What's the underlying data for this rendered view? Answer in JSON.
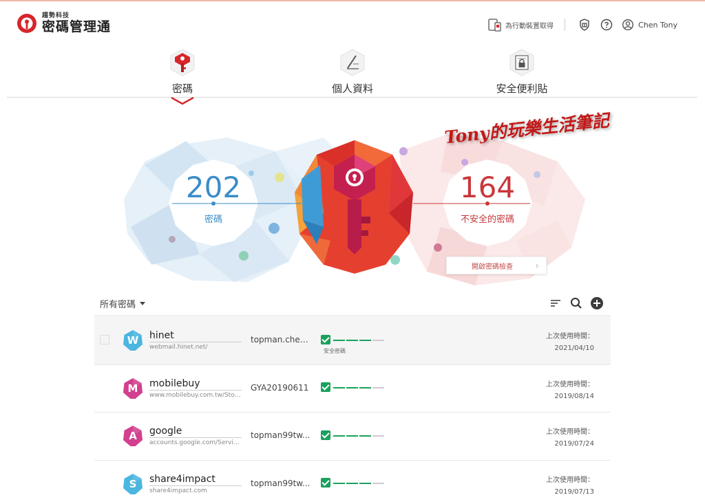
{
  "brand": {
    "company": "趨勢科技",
    "product": "密碼管理通",
    "accent": "#d6262b"
  },
  "header": {
    "mobile_label": "為行動裝置取得",
    "user_name": "Chen Tony",
    "icons": [
      "mobile-device-icon",
      "shield-gift-icon",
      "help-icon",
      "user-icon"
    ]
  },
  "tabs": [
    {
      "label": "密碼",
      "icon": "key-icon",
      "active": true
    },
    {
      "label": "個人資料",
      "icon": "pen-icon",
      "active": false
    },
    {
      "label": "安全便利貼",
      "icon": "secure-note-icon",
      "active": false
    }
  ],
  "summary": {
    "total_count": "202",
    "total_label": "密碼",
    "unsafe_count": "164",
    "unsafe_label": "不安全的密碼",
    "check_button": "開啟密碼檢查",
    "total_color": "#3a8cc9",
    "unsafe_color": "#c9373a"
  },
  "watermark": "Tony的玩樂生活筆記",
  "list": {
    "filter_label": "所有密碼",
    "toolbar_icons": [
      "sort-icon",
      "search-icon",
      "add-icon"
    ],
    "last_used_label": "上次使用時間：",
    "safe_label": "安全密碼",
    "items": [
      {
        "letter": "W",
        "color": "#4bb6e0",
        "name": "hinet",
        "url": "webmail.hinet.net/",
        "username": "topman.chen...",
        "date": "2021/04/10",
        "strength_level": 3,
        "strength_max": 4,
        "show_safe_label": true
      },
      {
        "letter": "M",
        "color": "#d2408f",
        "name": "mobilebuy",
        "url": "www.mobilebuy.com.tw/Store...",
        "username": "GYA20190611",
        "date": "2019/08/14",
        "strength_level": 3,
        "strength_max": 4,
        "show_safe_label": false
      },
      {
        "letter": "A",
        "color": "#d2408f",
        "name": "google",
        "url": "accounts.google.com/Service...",
        "username": "topman99tw...",
        "date": "2019/07/24",
        "strength_level": 3,
        "strength_max": 4,
        "show_safe_label": false
      },
      {
        "letter": "S",
        "color": "#4bb6e0",
        "name": "share4impact",
        "url": "share4impact.com",
        "username": "topman99tw...",
        "date": "2019/07/13",
        "strength_level": 3,
        "strength_max": 4,
        "show_safe_label": false
      }
    ]
  }
}
